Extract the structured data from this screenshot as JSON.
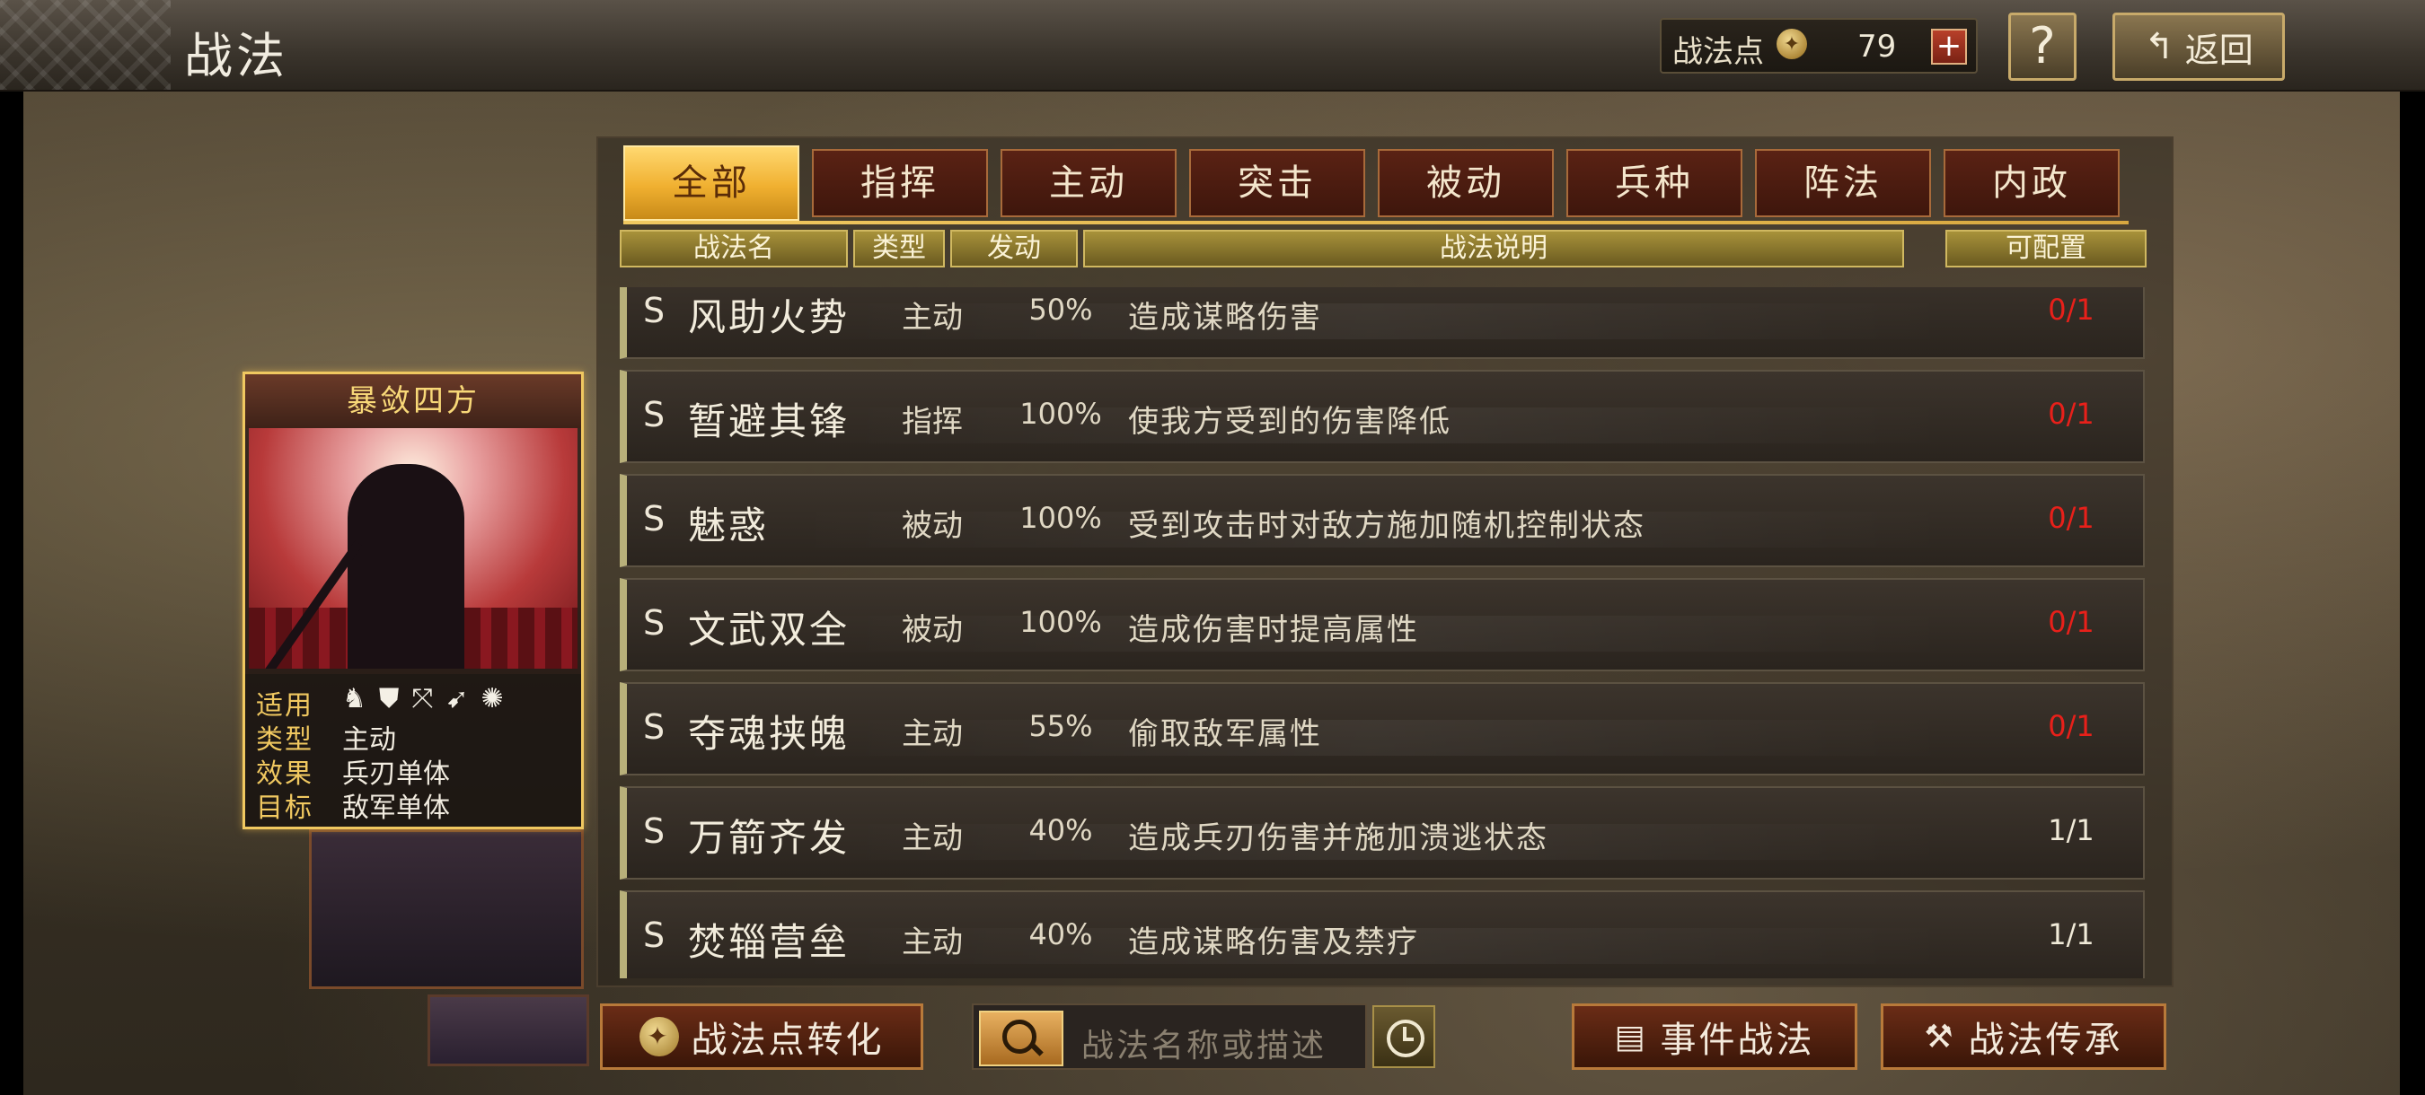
{
  "header": {
    "title": "战法",
    "points_label": "战法点",
    "points_value": "79",
    "add_label": "+",
    "help_label": "?",
    "back_label": "返回"
  },
  "tabs": [
    {
      "label": "全部",
      "active": true
    },
    {
      "label": "指挥",
      "active": false
    },
    {
      "label": "主动",
      "active": false
    },
    {
      "label": "突击",
      "active": false
    },
    {
      "label": "被动",
      "active": false
    },
    {
      "label": "兵种",
      "active": false
    },
    {
      "label": "阵法",
      "active": false
    },
    {
      "label": "内政",
      "active": false
    }
  ],
  "columns": {
    "name": "战法名",
    "type": "类型",
    "trigger": "发动",
    "description": "战法说明",
    "configurable": "可配置"
  },
  "tactics": [
    {
      "grade": "S",
      "name": "风助火势",
      "type": "主动",
      "rate": "50%",
      "desc": "造成谋略伤害",
      "slots": "0/1",
      "full": true
    },
    {
      "grade": "S",
      "name": "暂避其锋",
      "type": "指挥",
      "rate": "100%",
      "desc": "使我方受到的伤害降低",
      "slots": "0/1",
      "full": true
    },
    {
      "grade": "S",
      "name": "魅惑",
      "type": "被动",
      "rate": "100%",
      "desc": "受到攻击时对敌方施加随机控制状态",
      "slots": "0/1",
      "full": true
    },
    {
      "grade": "S",
      "name": "文武双全",
      "type": "被动",
      "rate": "100%",
      "desc": "造成伤害时提高属性",
      "slots": "0/1",
      "full": true
    },
    {
      "grade": "S",
      "name": "夺魂挟魄",
      "type": "主动",
      "rate": "55%",
      "desc": "偷取敌军属性",
      "slots": "0/1",
      "full": true
    },
    {
      "grade": "S",
      "name": "万箭齐发",
      "type": "主动",
      "rate": "40%",
      "desc": "造成兵刃伤害并施加溃逃状态",
      "slots": "1/1",
      "full": false
    },
    {
      "grade": "S",
      "name": "焚辎营垒",
      "type": "主动",
      "rate": "40%",
      "desc": "造成谋略伤害及禁疗",
      "slots": "1/1",
      "full": false
    }
  ],
  "card": {
    "title": "暴敛四方",
    "applies_label": "适用",
    "unit_icons": [
      "cavalry-icon",
      "shield-icon",
      "bow-icon",
      "spear-icon",
      "wheel-icon"
    ],
    "type_label": "类型",
    "type_value": "主动",
    "effect_label": "效果",
    "effect_value": "兵刃单体",
    "target_label": "目标",
    "target_value": "敌军单体"
  },
  "footer": {
    "convert_label": "战法点转化",
    "search_placeholder": "战法名称或描述",
    "event_label": "事件战法",
    "inherit_label": "战法传承"
  },
  "colors": {
    "accent_gold": "#f0c860",
    "tab_active": "#f0b030",
    "slots_full": "#e8201a"
  }
}
